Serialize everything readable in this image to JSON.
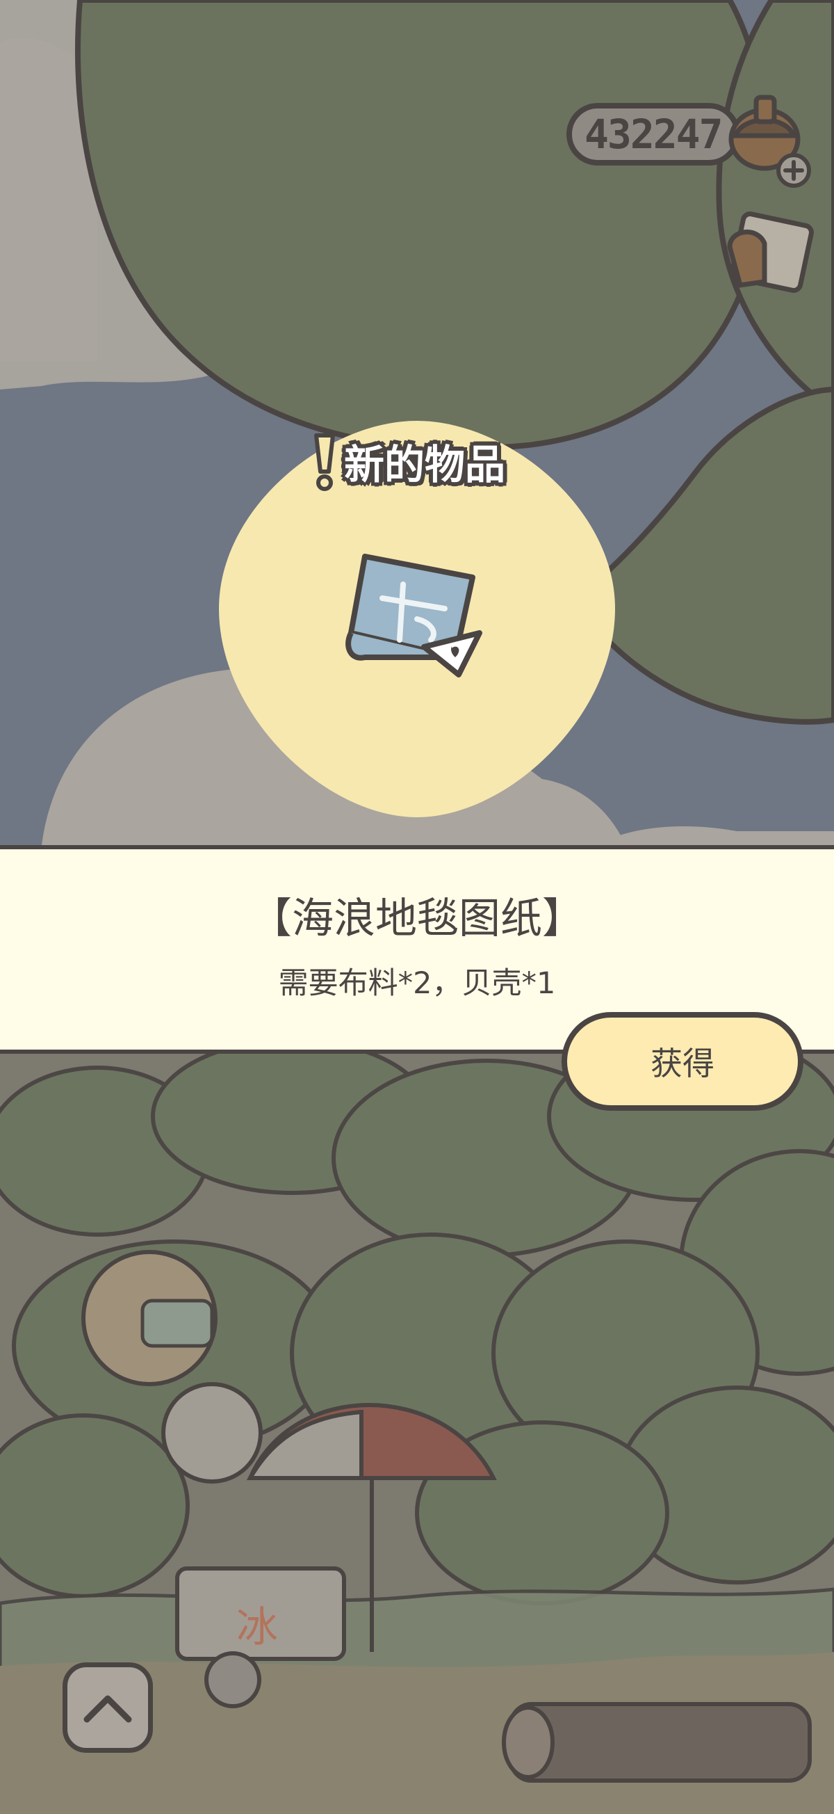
{
  "hud": {
    "coins_value": "432247",
    "coins_icon": "acorn-add-icon",
    "mail_icon": "letter-icon"
  },
  "popup": {
    "header_label": "新的物品",
    "header_icon": "exclamation-icon",
    "item_icon": "blueprint-scroll-icon",
    "item_title": "【海浪地毯图纸】",
    "item_requirement": "需要布料*2，贝壳*1",
    "obtain_button_label": "获得"
  },
  "controls": {
    "scroll_up_icon": "chevron-up-icon"
  },
  "colors": {
    "outline": "#4a4543",
    "panel_bg": "#fffce8",
    "button_bg": "#fdebb2",
    "badge_bg": "#f7e8b0",
    "sky": "#6f7684",
    "leaf": "#6b735f"
  }
}
